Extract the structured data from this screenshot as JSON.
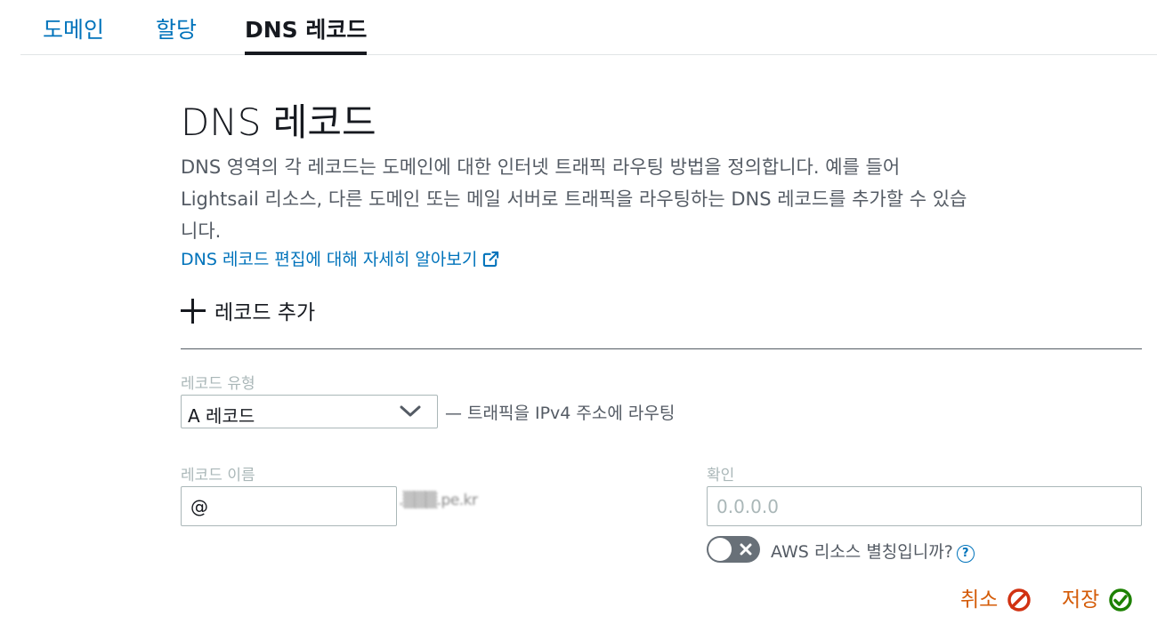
{
  "tabs": [
    {
      "label": "도메인",
      "active": false
    },
    {
      "label": "할당",
      "active": false
    },
    {
      "label": "DNS 레코드",
      "active": true
    }
  ],
  "header": {
    "title_prefix": "DNS",
    "title_suffix": "레코드",
    "description": "DNS 영역의 각 레코드는 도메인에 대한 인터넷 트래픽 라우팅 방법을 정의합니다. 예를 들어 Lightsail 리소스, 다른 도메인 또는 메일 서버로 트래픽을 라우팅하는 DNS 레코드를 추가할 수 있습니다.",
    "learn_more": "DNS 레코드 편집에 대해 자세히 알아보기"
  },
  "add_record": {
    "label": "레코드 추가"
  },
  "form": {
    "record_type_label": "레코드 유형",
    "record_type_value": "A 레코드",
    "record_type_hint": "— 트래픽을 IPv4 주소에 라우팅",
    "record_name_label": "레코드 이름",
    "record_name_value": "@",
    "domain_suffix": ".▒▒▒.pe.kr",
    "resolves_label": "확인",
    "resolves_placeholder": "0.0.0.0",
    "alias_label": "AWS 리소스 별칭입니까?",
    "help": "?"
  },
  "actions": {
    "cancel": "취소",
    "save": "저장"
  },
  "colors": {
    "link": "#0073bb",
    "action": "#d45b07",
    "cancel_icon": "#d13212",
    "save_icon": "#1d8102"
  }
}
